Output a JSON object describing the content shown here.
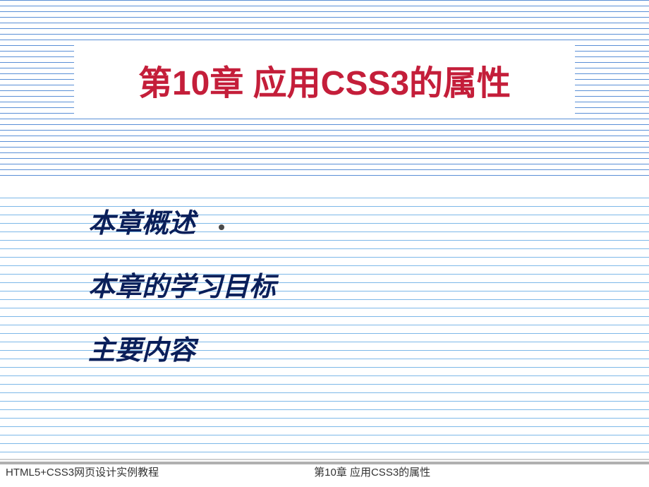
{
  "slide": {
    "title": "第10章  应用CSS3的属性",
    "items": [
      "本章概述",
      "本章的学习目标",
      "主要内容"
    ]
  },
  "footer": {
    "left": "HTML5+CSS3网页设计实例教程",
    "right": "第10章  应用CSS3的属性"
  }
}
